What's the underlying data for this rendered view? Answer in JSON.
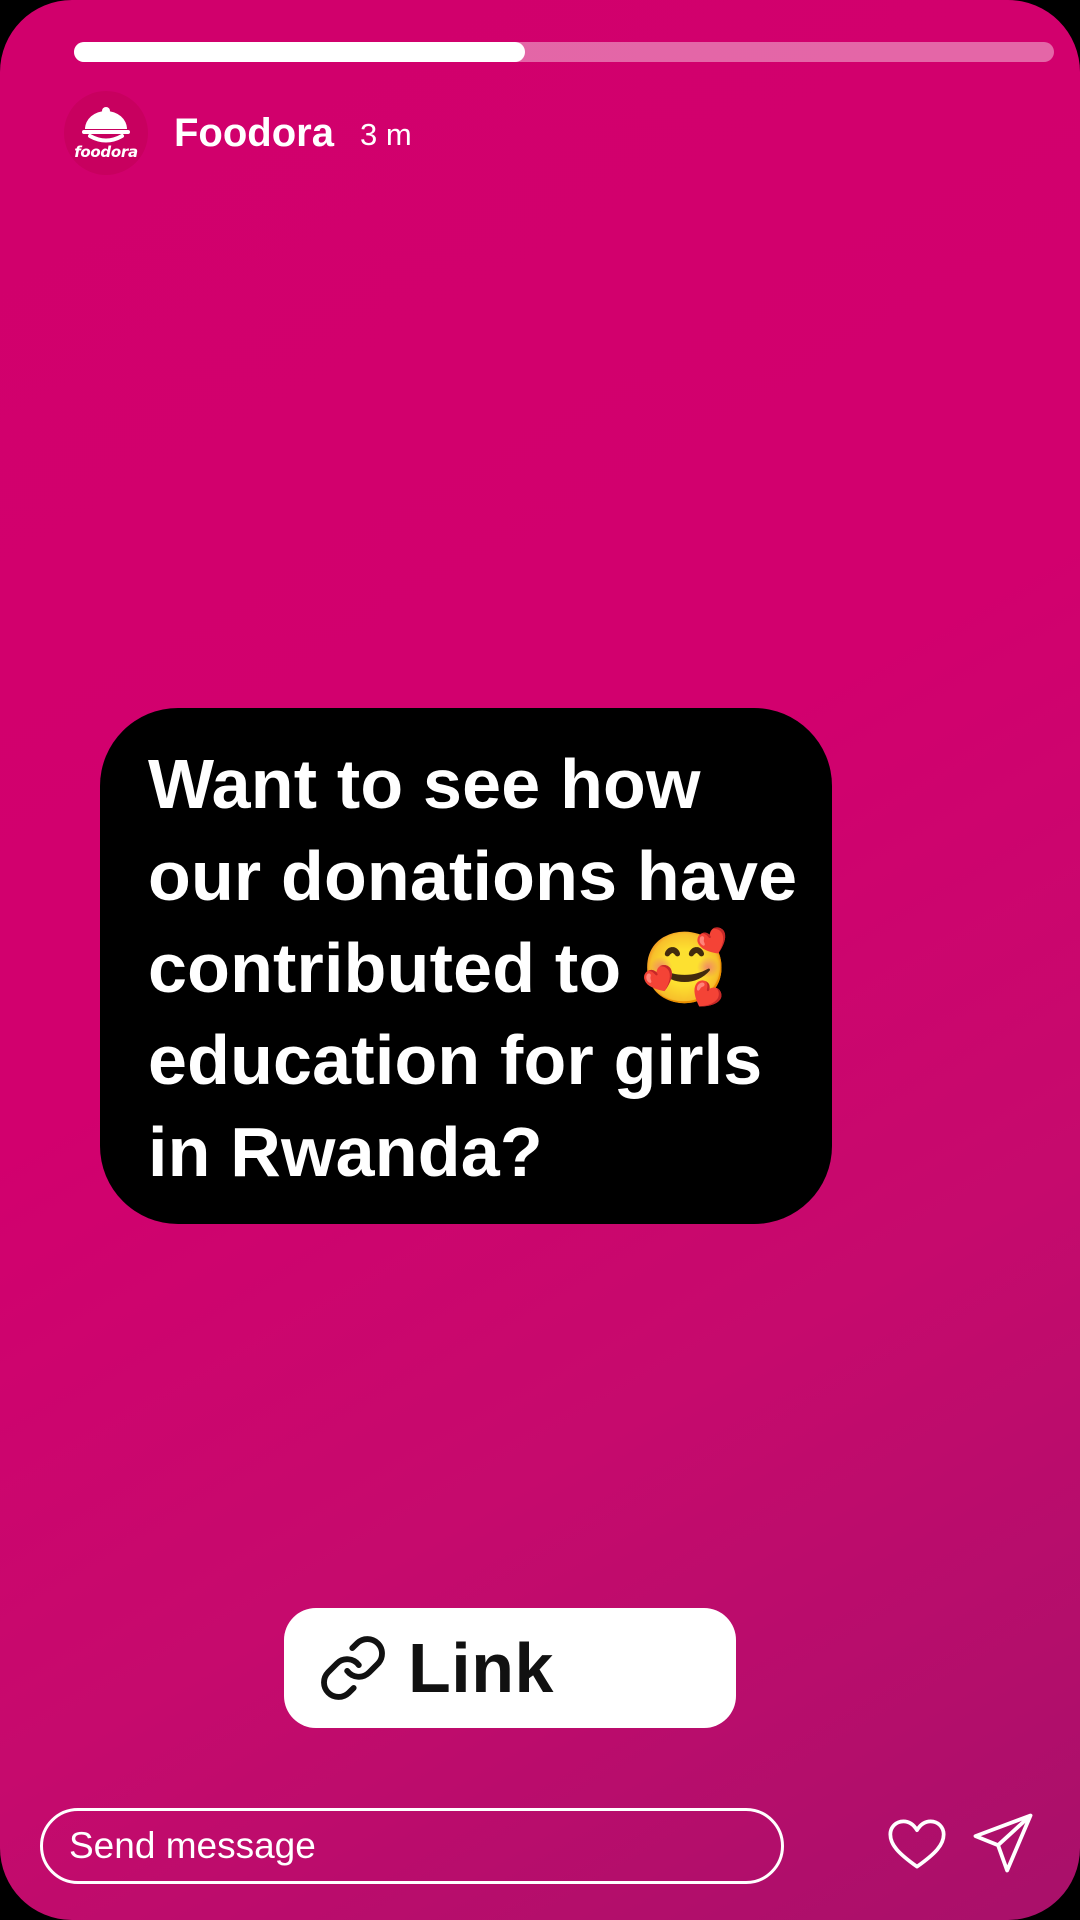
{
  "story": {
    "progress_percent": 46,
    "account": {
      "name": "Foodora",
      "logo_text": "foodora",
      "time_ago": "3 m"
    },
    "question": {
      "text_before_emoji": "Want to see how our donations have contributed to",
      "emoji": "🥰",
      "text_after_emoji": "education for girls in Rwanda?"
    },
    "link_sticker": {
      "label": "Link",
      "icon": "link-chain-icon"
    },
    "footer": {
      "message_placeholder": "Send message",
      "like_icon": "heart-icon",
      "share_icon": "paper-plane-icon"
    }
  },
  "colors": {
    "background_top": "#d1006c",
    "background_bottom": "#a8106a",
    "card": "#000000",
    "text": "#ffffff",
    "sticker": "#ffffff"
  }
}
